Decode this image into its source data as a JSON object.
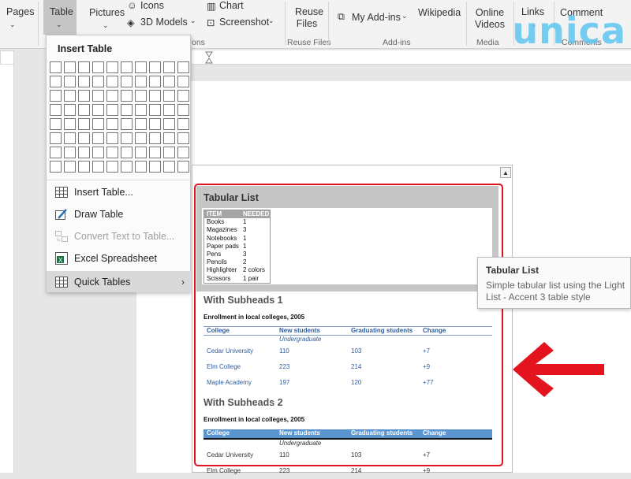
{
  "ribbon": {
    "pages": "Pages",
    "table": "Table",
    "pictures": "Pictures",
    "icons": "Icons",
    "models_3d": "3D Models",
    "chart": "Chart",
    "screenshot": "Screenshot",
    "illustrations_group": "ons",
    "reuse_files": "Reuse Files",
    "reuse_group": "Reuse Files",
    "my_addins": "My Add-ins",
    "wikipedia": "Wikipedia",
    "addins_group": "Add-ins",
    "online_videos": "Online Videos",
    "media_group": "Media",
    "links": "Links",
    "comment": "Comment",
    "comments_group": "Comments",
    "watermark": "unica"
  },
  "insert_table": {
    "title": "Insert Table",
    "items": [
      {
        "label": "Insert Table...",
        "icon": "table-grid-icon"
      },
      {
        "label": "Draw Table",
        "icon": "pencil-table-icon"
      },
      {
        "label": "Convert Text to Table...",
        "icon": "convert-icon"
      },
      {
        "label": "Excel Spreadsheet",
        "icon": "excel-icon"
      },
      {
        "label": "Quick Tables",
        "icon": "table-grid-icon"
      }
    ]
  },
  "gallery": {
    "tabular_list": {
      "title": "Tabular List",
      "header": [
        "ITEM",
        "NEEDED"
      ],
      "rows": [
        [
          "Books",
          "1"
        ],
        [
          "Magazines",
          "3"
        ],
        [
          "Notebooks",
          "1"
        ],
        [
          "Paper pads",
          "1"
        ],
        [
          "Pens",
          "3"
        ],
        [
          "Pencils",
          "2"
        ],
        [
          "Highlighter",
          "2 colors"
        ],
        [
          "Scissors",
          "1 pair"
        ]
      ]
    },
    "subheads1": {
      "title": "With Subheads 1",
      "caption": "Enrollment in local colleges, 2005",
      "header": [
        "College",
        "New students",
        "Graduating students",
        "Change"
      ],
      "subhead": "Undergraduate",
      "rows": [
        [
          "Cedar University",
          "110",
          "103",
          "+7"
        ],
        [
          "Elm College",
          "223",
          "214",
          "+9"
        ],
        [
          "Maple Academy",
          "197",
          "120",
          "+77"
        ]
      ]
    },
    "subheads2": {
      "title": "With Subheads 2",
      "caption": "Enrollment in local colleges, 2005",
      "header": [
        "College",
        "New students",
        "Graduating students",
        "Change"
      ],
      "subhead": "Undergraduate",
      "rows": [
        [
          "Cedar University",
          "110",
          "103",
          "+7"
        ],
        [
          "Elm College",
          "223",
          "214",
          "+9"
        ]
      ]
    }
  },
  "tooltip": {
    "title": "Tabular List",
    "description": "Simple tabular list using the Light List - Accent 3 table style"
  }
}
